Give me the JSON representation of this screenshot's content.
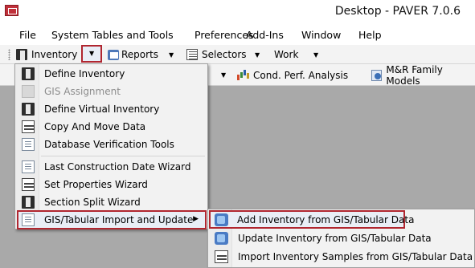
{
  "app": {
    "window_title": "Desktop - PAVER 7.0.6"
  },
  "menubar": {
    "items": [
      "File",
      "System Tables and Tools",
      "Preferences",
      "Add-Ins",
      "Window",
      "Help"
    ]
  },
  "toolbar": {
    "inventory_label": "Inventory",
    "reports_label": "Reports",
    "selectors_label": "Selectors",
    "work_label": "Work",
    "cond_perf_label": "Cond. Perf. Analysis",
    "mr_family_label": "M&R Family Models"
  },
  "inventory_menu": {
    "items": [
      {
        "label": "Define Inventory",
        "icon": "inventory-book-icon",
        "enabled": true
      },
      {
        "label": "GIS Assignment",
        "icon": "gis-icon",
        "enabled": false
      },
      {
        "label": "Define Virtual Inventory",
        "icon": "virtual-inventory-icon",
        "enabled": true
      },
      {
        "label": "Copy And Move Data",
        "icon": "copy-move-icon",
        "enabled": true
      },
      {
        "label": "Database Verification Tools",
        "icon": "database-verify-icon",
        "enabled": true
      },
      {
        "label": "Last Construction Date Wizard",
        "icon": "construction-date-icon",
        "enabled": true
      },
      {
        "label": "Set Properties Wizard",
        "icon": "properties-icon",
        "enabled": true
      },
      {
        "label": "Section Split Wizard",
        "icon": "section-split-icon",
        "enabled": true
      },
      {
        "label": "GIS/Tabular Import and Update",
        "icon": "import-update-icon",
        "enabled": true,
        "submenu": true
      }
    ]
  },
  "import_submenu": {
    "items": [
      {
        "label": "Add Inventory from GIS/Tabular Data",
        "icon": "add-inventory-icon"
      },
      {
        "label": "Update Inventory from GIS/Tabular Data",
        "icon": "update-inventory-icon"
      },
      {
        "label": "Import Inventory Samples from GIS/Tabular Data",
        "icon": "import-samples-icon"
      }
    ]
  },
  "colors": {
    "highlight_border": "#b02630",
    "workspace": "#a9a9a9",
    "menu_bg": "#f2f2f2"
  }
}
